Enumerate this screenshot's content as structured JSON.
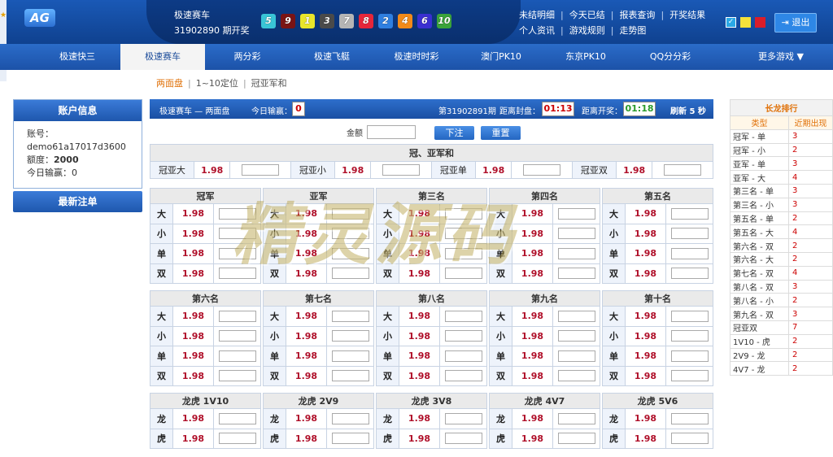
{
  "header": {
    "logo": "AG",
    "game_title": "极速赛车",
    "period_text": "31902890 期开奖",
    "balls": [
      {
        "num": "5",
        "color": "#39c4d6"
      },
      {
        "num": "9",
        "color": "#7a1414"
      },
      {
        "num": "1",
        "color": "#e8e52a"
      },
      {
        "num": "3",
        "color": "#4a4a4a"
      },
      {
        "num": "7",
        "color": "#b5b5b5"
      },
      {
        "num": "8",
        "color": "#e5263a"
      },
      {
        "num": "2",
        "color": "#2f7fe0"
      },
      {
        "num": "4",
        "color": "#f28a19"
      },
      {
        "num": "6",
        "color": "#3a2fd1"
      },
      {
        "num": "10",
        "color": "#3aa33a"
      }
    ],
    "links_row1": [
      "未结明细",
      "今天已结",
      "报表查询",
      "开奖结果"
    ],
    "links_row2": [
      "个人资讯",
      "游戏规则",
      "走势图"
    ],
    "theme_colors": [
      "#2aa8e6",
      "#f5e23a",
      "#d91d2a"
    ],
    "logout_label": "退出"
  },
  "nav": {
    "items": [
      "极速快三",
      "极速赛车",
      "两分彩",
      "极速飞艇",
      "极速时时彩",
      "澳门PK10",
      "东京PK10",
      "QQ分分彩",
      "更多游戏 ▼"
    ],
    "active_index": 1
  },
  "subnav": [
    "两面盘",
    "1~10定位",
    "冠亚军和"
  ],
  "account": {
    "title": "账户信息",
    "account_label": "账号：",
    "account_value": "demo61a17017d3600",
    "credit_label": "额度：",
    "credit_value": "2000",
    "today_label": "今日输赢：0",
    "recent_button": "最新注单"
  },
  "info_bar": {
    "title": "极速赛车 — 两面盘",
    "today_label": "今日输赢：",
    "today_value": "0",
    "period": "第31902891期",
    "close_label": "距离封盘：",
    "close_time": "01:13",
    "open_label": "距离开奖：",
    "open_time": "01:18",
    "refresh": "刷新 5 秒"
  },
  "bet": {
    "amount_label": "金额",
    "submit": "下注",
    "reset": "重置"
  },
  "sum_section": {
    "title": "冠、亚军和",
    "items": [
      {
        "label": "冠亚大",
        "odds": "1.98"
      },
      {
        "label": "冠亚小",
        "odds": "1.98"
      },
      {
        "label": "冠亚单",
        "odds": "1.98"
      },
      {
        "label": "冠亚双",
        "odds": "1.98"
      }
    ]
  },
  "positions_row1": [
    "冠军",
    "亚军",
    "第三名",
    "第四名",
    "第五名"
  ],
  "positions_row2": [
    "第六名",
    "第七名",
    "第八名",
    "第九名",
    "第十名"
  ],
  "position_options": [
    "大",
    "小",
    "单",
    "双"
  ],
  "dragon_tiger": [
    "龙虎 1V10",
    "龙虎 2V9",
    "龙虎 3V8",
    "龙虎 4V7",
    "龙虎 5V6"
  ],
  "dragon_options": [
    "龙",
    "虎"
  ],
  "odds": "1.98",
  "long_dragon": {
    "title": "长龙排行",
    "col_type": "类型",
    "col_count": "近期出现",
    "rows": [
      [
        "冠军 - 单",
        "3"
      ],
      [
        "冠军 - 小",
        "2"
      ],
      [
        "亚军 - 单",
        "3"
      ],
      [
        "亚军 - 大",
        "4"
      ],
      [
        "第三名 - 单",
        "3"
      ],
      [
        "第三名 - 小",
        "3"
      ],
      [
        "第五名 - 单",
        "2"
      ],
      [
        "第五名 - 大",
        "4"
      ],
      [
        "第六名 - 双",
        "2"
      ],
      [
        "第六名 - 大",
        "2"
      ],
      [
        "第七名 - 双",
        "4"
      ],
      [
        "第八名 - 双",
        "3"
      ],
      [
        "第八名 - 小",
        "2"
      ],
      [
        "第九名 - 双",
        "3"
      ],
      [
        "冠亚双",
        "7"
      ],
      [
        "1V10 - 虎",
        "2"
      ],
      [
        "2V9 - 龙",
        "2"
      ],
      [
        "4V7 - 龙",
        "2"
      ]
    ]
  },
  "watermark": "精灵源码"
}
